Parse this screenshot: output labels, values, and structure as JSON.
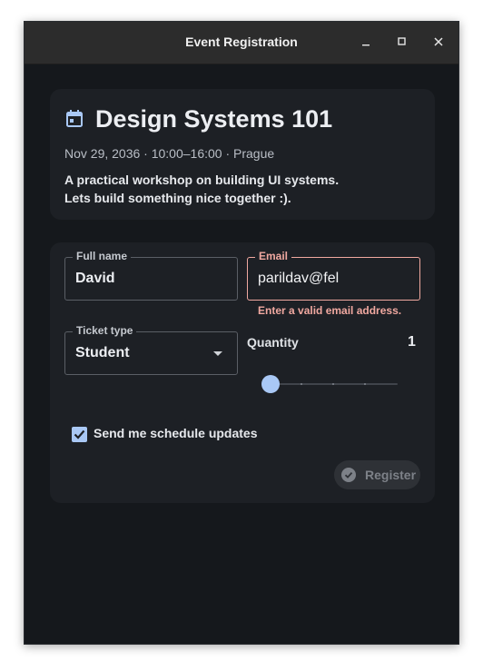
{
  "window": {
    "title": "Event Registration"
  },
  "event": {
    "icon": "calendar-icon",
    "title": "Design Systems 101",
    "meta": "Nov 29, 2036 · 10:00–16:00 · Prague",
    "description_line1": "A practical workshop on building UI systems.",
    "description_line2": "Lets build something nice together :)."
  },
  "form": {
    "full_name": {
      "label": "Full name",
      "value": "David"
    },
    "email": {
      "label": "Email",
      "value": "parildav@fel",
      "error": "Enter a valid email address."
    },
    "ticket_type": {
      "label": "Ticket type",
      "value": "Student"
    },
    "quantity": {
      "label": "Quantity",
      "value": "1",
      "slider_fraction": 0.0
    },
    "schedule_updates": {
      "label": "Send me schedule updates",
      "checked": true
    },
    "register": {
      "label": "Register",
      "enabled": false
    }
  },
  "colors": {
    "accent": "#a9c8f5",
    "error": "#f0a8a0",
    "background": "#15181c",
    "card": "#1d2025"
  }
}
